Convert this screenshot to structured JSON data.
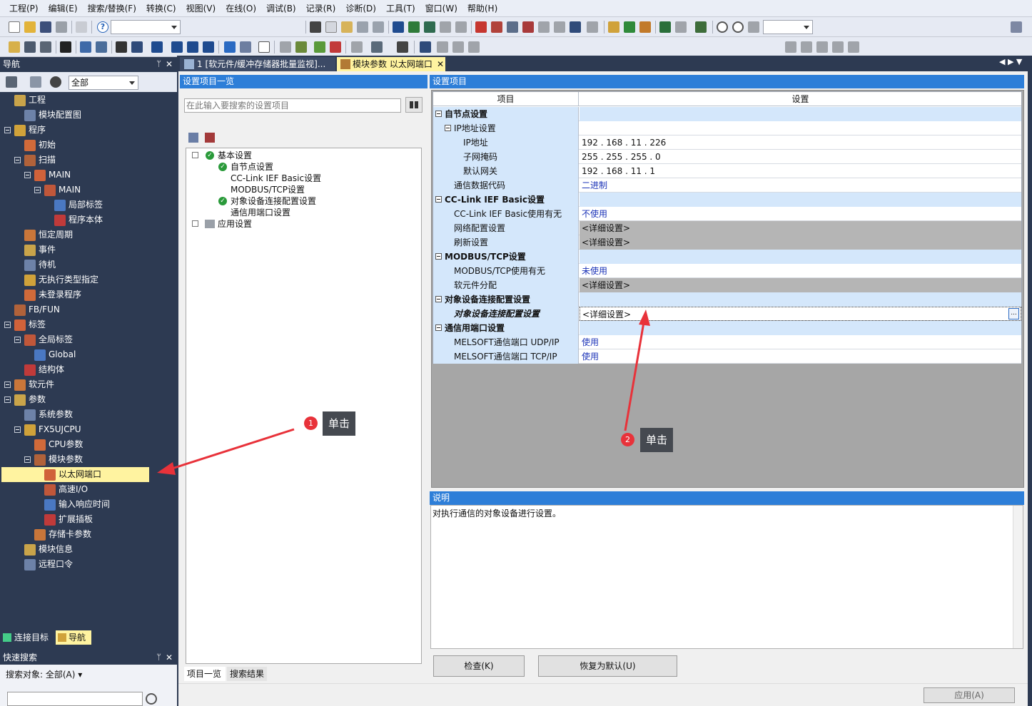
{
  "menu": [
    "工程(P)",
    "编辑(E)",
    "搜索/替换(F)",
    "转换(C)",
    "视图(V)",
    "在线(O)",
    "调试(B)",
    "记录(R)",
    "诊断(D)",
    "工具(T)",
    "窗口(W)",
    "帮助(H)"
  ],
  "nav": {
    "title": "导航",
    "filter_value": "全部",
    "tree": [
      {
        "label": "工程",
        "level": 0,
        "expand": false
      },
      {
        "label": "模块配置图",
        "level": 1,
        "expand": false
      },
      {
        "label": "程序",
        "level": 0,
        "expand": true
      },
      {
        "label": "初始",
        "level": 1,
        "expand": false
      },
      {
        "label": "扫描",
        "level": 1,
        "expand": true
      },
      {
        "label": "MAIN",
        "level": 2,
        "expand": true
      },
      {
        "label": "MAIN",
        "level": 3,
        "expand": true
      },
      {
        "label": "局部标签",
        "level": 4,
        "expand": false
      },
      {
        "label": "程序本体",
        "level": 4,
        "expand": false
      },
      {
        "label": "恒定周期",
        "level": 1,
        "expand": false
      },
      {
        "label": "事件",
        "level": 1,
        "expand": false
      },
      {
        "label": "待机",
        "level": 1,
        "expand": false
      },
      {
        "label": "无执行类型指定",
        "level": 1,
        "expand": false
      },
      {
        "label": "未登录程序",
        "level": 1,
        "expand": false
      },
      {
        "label": "FB/FUN",
        "level": 0,
        "expand": false
      },
      {
        "label": "标签",
        "level": 0,
        "expand": true
      },
      {
        "label": "全局标签",
        "level": 1,
        "expand": true
      },
      {
        "label": "Global",
        "level": 2,
        "expand": false
      },
      {
        "label": "结构体",
        "level": 1,
        "expand": false
      },
      {
        "label": "软元件",
        "level": 0,
        "expand": true
      },
      {
        "label": "参数",
        "level": 0,
        "expand": true
      },
      {
        "label": "系统参数",
        "level": 1,
        "expand": false
      },
      {
        "label": "FX5UJCPU",
        "level": 1,
        "expand": true
      },
      {
        "label": "CPU参数",
        "level": 2,
        "expand": false
      },
      {
        "label": "模块参数",
        "level": 2,
        "expand": true
      },
      {
        "label": "以太网端口",
        "level": 3,
        "expand": false,
        "selected": true
      },
      {
        "label": "高速I/O",
        "level": 3,
        "expand": false
      },
      {
        "label": "输入响应时间",
        "level": 3,
        "expand": false
      },
      {
        "label": "扩展插板",
        "level": 3,
        "expand": false
      },
      {
        "label": "存储卡参数",
        "level": 2,
        "expand": false
      },
      {
        "label": "模块信息",
        "level": 1,
        "expand": false
      },
      {
        "label": "远程口令",
        "level": 1,
        "expand": false
      }
    ],
    "bottom_tabs": [
      "连接目标",
      "导航"
    ]
  },
  "quick_search": {
    "title": "快速搜索",
    "target": "搜索对象: 全部(A)"
  },
  "doc_tabs": [
    {
      "label": "1 [软元件/缓冲存储器批量监视]..."
    },
    {
      "label": "模块参数 以太网端口"
    }
  ],
  "settings_list": {
    "title": "设置项目一览",
    "search_placeholder": "在此输入要搜索的设置项目",
    "tree": [
      {
        "label": "基本设置",
        "level": 0,
        "check": true
      },
      {
        "label": "自节点设置",
        "level": 1,
        "check": true
      },
      {
        "label": "CC-Link IEF Basic设置",
        "level": 1,
        "check": false
      },
      {
        "label": "MODBUS/TCP设置",
        "level": 1,
        "check": false
      },
      {
        "label": "对象设备连接配置设置",
        "level": 1,
        "check": true
      },
      {
        "label": "通信用端口设置",
        "level": 1,
        "check": false
      },
      {
        "label": "应用设置",
        "level": 0,
        "check": false
      }
    ],
    "bottom_tabs": [
      "项目一览",
      "搜索结果"
    ]
  },
  "settings": {
    "title": "设置项目",
    "col_item": "项目",
    "col_value": "设置",
    "rows": [
      {
        "item": "自节点设置",
        "value": "",
        "kind": "section"
      },
      {
        "item": "IP地址设置",
        "value": "",
        "kind": "subsection"
      },
      {
        "item": "IP地址",
        "value": "192 . 168 .  11 . 226",
        "kind": "leaf2"
      },
      {
        "item": "子网掩码",
        "value": "255 . 255 . 255 .   0",
        "kind": "leaf2"
      },
      {
        "item": "默认网关",
        "value": "192 . 168 .  11 .   1",
        "kind": "leaf2"
      },
      {
        "item": "通信数据代码",
        "value": "二进制",
        "kind": "leaf",
        "blue": true
      },
      {
        "item": "CC-Link IEF Basic设置",
        "value": "",
        "kind": "section"
      },
      {
        "item": "CC-Link IEF Basic使用有无",
        "value": "不使用",
        "kind": "leaf",
        "blue": true
      },
      {
        "item": "网络配置设置",
        "value": "<详细设置>",
        "kind": "leaf",
        "gray": true
      },
      {
        "item": "刷新设置",
        "value": "<详细设置>",
        "kind": "leaf",
        "gray": true
      },
      {
        "item": "MODBUS/TCP设置",
        "value": "",
        "kind": "section"
      },
      {
        "item": "MODBUS/TCP使用有无",
        "value": "未使用",
        "kind": "leaf",
        "blue": true
      },
      {
        "item": "软元件分配",
        "value": "<详细设置>",
        "kind": "leaf",
        "gray": true
      },
      {
        "item": "对象设备连接配置设置",
        "value": "",
        "kind": "section"
      },
      {
        "item": "对象设备连接配置设置",
        "value": "<详细设置>",
        "kind": "leaf",
        "focus": true
      },
      {
        "item": "通信用端口设置",
        "value": "",
        "kind": "section"
      },
      {
        "item": "MELSOFT通信端口 UDP/IP",
        "value": "使用",
        "kind": "leaf",
        "blue": true
      },
      {
        "item": "MELSOFT通信端口 TCP/IP",
        "value": "使用",
        "kind": "leaf",
        "blue": true
      }
    ]
  },
  "description": {
    "title": "说明",
    "text": "对执行通信的对象设备进行设置。"
  },
  "buttons": {
    "check": "检查(K)",
    "restore": "恢复为默认(U)",
    "apply": "应用(A)"
  },
  "annotations": [
    {
      "badge": "1",
      "text": "单击"
    },
    {
      "badge": "2",
      "text": "单击"
    }
  ],
  "colors": {
    "accent_blue": "#2d7ed8",
    "frame": "#2d3a52",
    "callout_red": "#e8323a"
  }
}
